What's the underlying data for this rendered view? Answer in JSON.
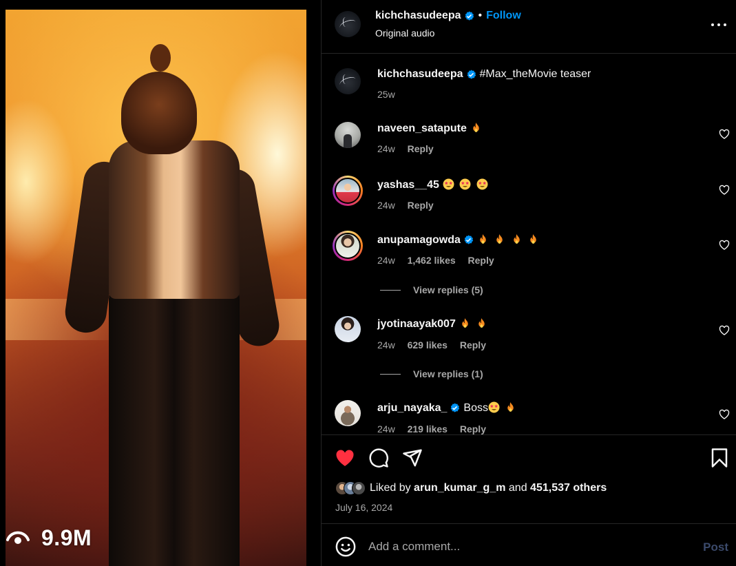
{
  "video": {
    "views": "9.9M",
    "eye_icon": "eye-icon"
  },
  "header": {
    "username": "kichchasudeepa",
    "separator": "•",
    "follow_label": "Follow",
    "subtitle": "Original audio",
    "more_icon": "more-horizontal-icon"
  },
  "caption": {
    "username": "kichchasudeepa",
    "text": "#Max_theMovie teaser",
    "time": "25w"
  },
  "comments": [
    {
      "username": "naveen_satapute",
      "text": "",
      "emojis": [
        "fire"
      ],
      "time": "24w",
      "likes": "",
      "reply": "Reply",
      "verified": false
    },
    {
      "username": "yashas__45",
      "text": "",
      "emojis": [
        "star-struck",
        "star-struck",
        "star-struck"
      ],
      "time": "24w",
      "likes": "",
      "reply": "Reply",
      "verified": false
    },
    {
      "username": "anupamagowda",
      "text": "",
      "emojis": [
        "fire",
        "fire",
        "fire",
        "fire"
      ],
      "time": "24w",
      "likes": "1,462 likes",
      "reply": "Reply",
      "verified": true,
      "view_replies": "View replies (5)"
    },
    {
      "username": "jyotinaayak007",
      "text": "",
      "emojis": [
        "fire",
        "fire"
      ],
      "time": "24w",
      "likes": "629 likes",
      "reply": "Reply",
      "verified": false,
      "view_replies": "View replies (1)"
    },
    {
      "username": "arju_nayaka_",
      "text": "Boss",
      "emojis": [
        "star-struck",
        "fire"
      ],
      "time": "24w",
      "likes": "219 likes",
      "reply": "Reply",
      "verified": true
    }
  ],
  "actions": {
    "like_icon": "heart-filled-icon",
    "comment_icon": "comment-icon",
    "share_icon": "share-icon",
    "save_icon": "bookmark-icon",
    "liked_by_prefix": "Liked by",
    "liked_by_user": "arun_kumar_g_m",
    "liked_by_and": "and",
    "liked_by_others": "451,537 others",
    "date": "July 16, 2024"
  },
  "add_comment": {
    "placeholder": "Add a comment...",
    "post_label": "Post"
  },
  "colors": {
    "accent": "#0095f6",
    "like_red": "#ff3040",
    "muted": "#a8a8a8",
    "background": "#000000",
    "post_disabled": "#3b4a6b"
  }
}
